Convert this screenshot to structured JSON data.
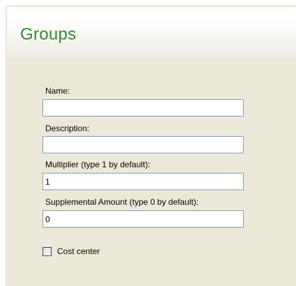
{
  "header": {
    "title": "Groups"
  },
  "form": {
    "name": {
      "label": "Name:",
      "value": ""
    },
    "description": {
      "label": "Description:",
      "value": ""
    },
    "multiplier": {
      "label": "Multiplier (type 1 by default):",
      "value": "1"
    },
    "supplemental_amount": {
      "label": "Supplemental Amount (type 0 by default):",
      "value": "0"
    },
    "cost_center": {
      "label": "Cost center",
      "checked": false
    }
  },
  "colors": {
    "title": "#2e8b2e",
    "panel_background": "#ece9d8",
    "input_border": "#7f9db9",
    "checkbox_border": "#1c5180"
  }
}
